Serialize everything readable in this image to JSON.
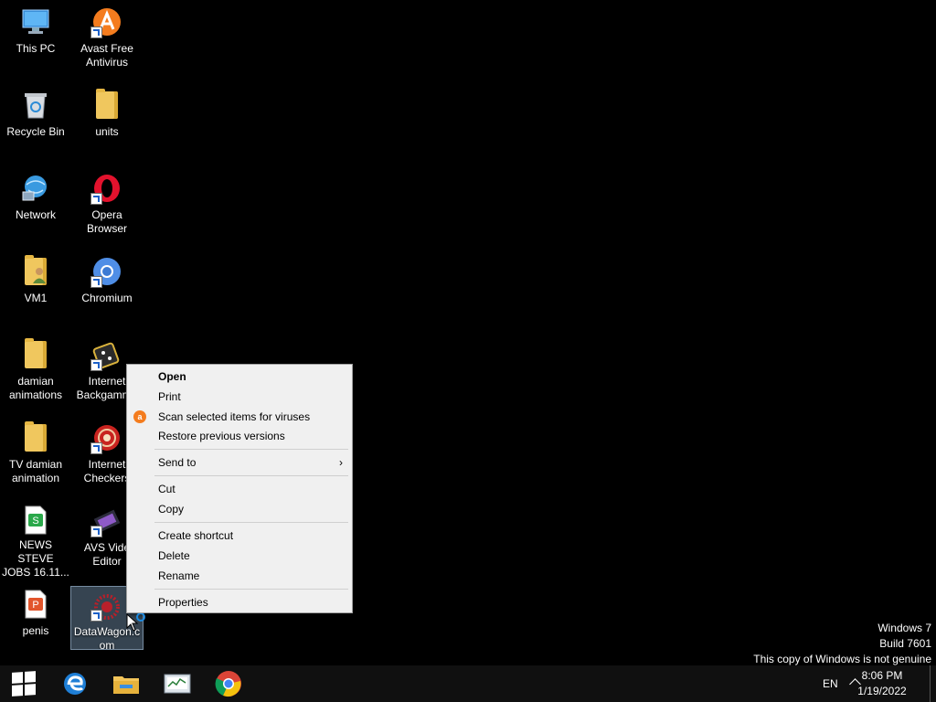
{
  "desktop": {
    "icons": [
      {
        "label": "This PC",
        "icon": "computer-icon"
      },
      {
        "label": "Avast Free\nAntivirus",
        "icon": "avast-icon"
      },
      {
        "label": "Recycle Bin",
        "icon": "recycle-bin-icon"
      },
      {
        "label": "units",
        "icon": "folder-icon"
      },
      {
        "label": "Network",
        "icon": "network-icon"
      },
      {
        "label": "Opera\nBrowser",
        "icon": "opera-icon"
      },
      {
        "label": "VM1",
        "icon": "user-folder-icon"
      },
      {
        "label": "Chromium",
        "icon": "chromium-icon"
      },
      {
        "label": "damian\nanimations",
        "icon": "folder-icon"
      },
      {
        "label": "Internet\nBackgammo",
        "icon": "backgammon-icon"
      },
      {
        "label": "TV  damian\nanimation",
        "icon": "folder-icon"
      },
      {
        "label": "Internet\nCheckers",
        "icon": "checkers-icon"
      },
      {
        "label": "NEWS STEVE\nJOBS 16.11...",
        "icon": "spreadsheet-icon"
      },
      {
        "label": "AVS Vide\nEditor",
        "icon": "video-editor-icon"
      },
      {
        "label": "penis",
        "icon": "presentation-icon"
      },
      {
        "label": "DataWagon.c\nom",
        "icon": "datawagon-icon"
      }
    ]
  },
  "context_menu": {
    "items": [
      {
        "label": "Open",
        "bold": true
      },
      {
        "label": "Print"
      },
      {
        "label": "Scan selected items for viruses",
        "icon": "avast-icon"
      },
      {
        "label": "Restore previous versions"
      },
      {
        "label": "Send to",
        "submenu": "›"
      },
      {
        "label": "Cut"
      },
      {
        "label": "Copy"
      },
      {
        "label": "Create shortcut"
      },
      {
        "label": "Delete"
      },
      {
        "label": "Rename"
      },
      {
        "label": "Properties"
      }
    ]
  },
  "watermark": {
    "line1": "Windows 7",
    "line2": "Build 7601",
    "line3": "This copy of Windows is not genuine"
  },
  "taskbar": {
    "apps": [
      "start-icon",
      "edge-icon",
      "file-explorer-icon",
      "task-manager-icon",
      "chrome-icon"
    ],
    "language": "EN",
    "time": "8:06 PM",
    "date": "1/19/2022"
  },
  "colors": {
    "desktop_bg": "#000000",
    "menu_bg": "#f0f0f0",
    "avast_orange": "#f47c1e",
    "taskbar_bg": "#101010"
  }
}
